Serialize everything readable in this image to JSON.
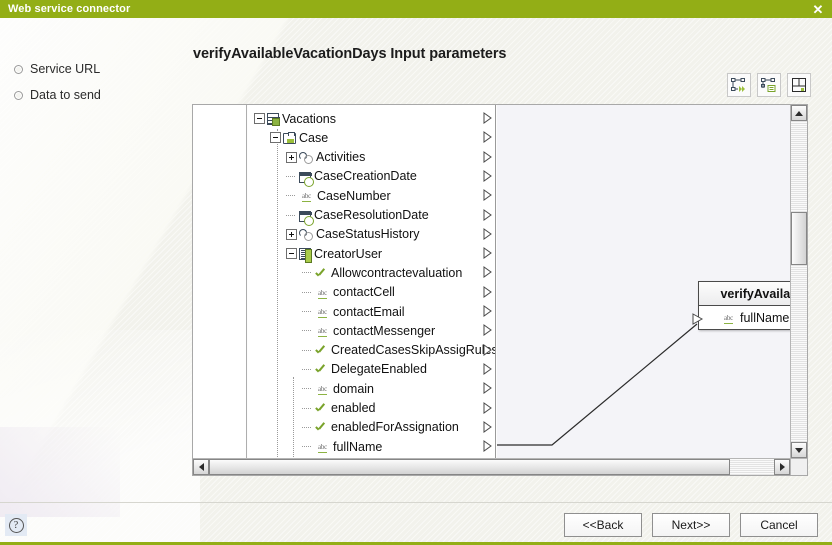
{
  "window": {
    "title": "Web service connector",
    "close_label": "✕",
    "accent_color": "#93ae16"
  },
  "nav": {
    "items": [
      {
        "label": "Service URL",
        "icon": "bullet-icon"
      },
      {
        "label": "Data to send",
        "icon": "bullet-icon"
      }
    ]
  },
  "page": {
    "title": "verifyAvailableVacationDays Input parameters"
  },
  "toolbar": {
    "buttons": [
      {
        "name": "auto-map-button",
        "icon": "auto-map-icon"
      },
      {
        "name": "map-properties-button",
        "icon": "map-properties-icon"
      },
      {
        "name": "layout-button",
        "icon": "layout-icon"
      }
    ]
  },
  "tree": {
    "nodes": [
      {
        "label": "Vacations",
        "depth": 0,
        "twisty": "minus",
        "icon": "table-icon",
        "arrow": true
      },
      {
        "label": "Case",
        "depth": 1,
        "twisty": "minus",
        "icon": "case-icon",
        "arrow": true
      },
      {
        "label": "Activities",
        "depth": 2,
        "twisty": "plus",
        "icon": "relation-icon",
        "arrow": true
      },
      {
        "label": "CaseCreationDate",
        "depth": 2,
        "twisty": "none",
        "icon": "date-icon",
        "arrow": true
      },
      {
        "label": "CaseNumber",
        "depth": 2,
        "twisty": "none",
        "icon": "abc-icon",
        "arrow": true
      },
      {
        "label": "CaseResolutionDate",
        "depth": 2,
        "twisty": "none",
        "icon": "date-icon",
        "arrow": true
      },
      {
        "label": "CaseStatusHistory",
        "depth": 2,
        "twisty": "plus",
        "icon": "relation-icon",
        "arrow": true
      },
      {
        "label": "CreatorUser",
        "depth": 2,
        "twisty": "minus",
        "icon": "user-icon",
        "arrow": true
      },
      {
        "label": "Allowcontractevaluation",
        "depth": 3,
        "twisty": "none",
        "icon": "check-icon",
        "arrow": true
      },
      {
        "label": "contactCell",
        "depth": 3,
        "twisty": "none",
        "icon": "abc-icon",
        "arrow": true
      },
      {
        "label": "contactEmail",
        "depth": 3,
        "twisty": "none",
        "icon": "abc-icon",
        "arrow": true
      },
      {
        "label": "contactMessenger",
        "depth": 3,
        "twisty": "none",
        "icon": "abc-icon",
        "arrow": true
      },
      {
        "label": "CreatedCasesSkipAssigRules",
        "depth": 3,
        "twisty": "none",
        "icon": "check-icon",
        "arrow": true
      },
      {
        "label": "DelegateEnabled",
        "depth": 3,
        "twisty": "none",
        "icon": "check-icon",
        "arrow": true
      },
      {
        "label": "domain",
        "depth": 3,
        "twisty": "none",
        "icon": "abc-icon",
        "arrow": true
      },
      {
        "label": "enabled",
        "depth": 3,
        "twisty": "none",
        "icon": "check-icon",
        "arrow": true
      },
      {
        "label": "enabledForAssignation",
        "depth": 3,
        "twisty": "none",
        "icon": "check-icon",
        "arrow": true
      },
      {
        "label": "fullName",
        "depth": 3,
        "twisty": "none",
        "icon": "abc-icon",
        "arrow": true
      }
    ]
  },
  "target_node": {
    "header": "verifyAvailableVacationDays",
    "rows": [
      {
        "label": "fullName",
        "icon": "abc-icon",
        "arrow": true
      }
    ]
  },
  "abc_glyph": "abc",
  "footer": {
    "help_label": "?",
    "buttons": [
      {
        "name": "back-button",
        "label": "<<Back"
      },
      {
        "name": "next-button",
        "label": "Next>>"
      },
      {
        "name": "cancel-button",
        "label": "Cancel"
      }
    ]
  }
}
